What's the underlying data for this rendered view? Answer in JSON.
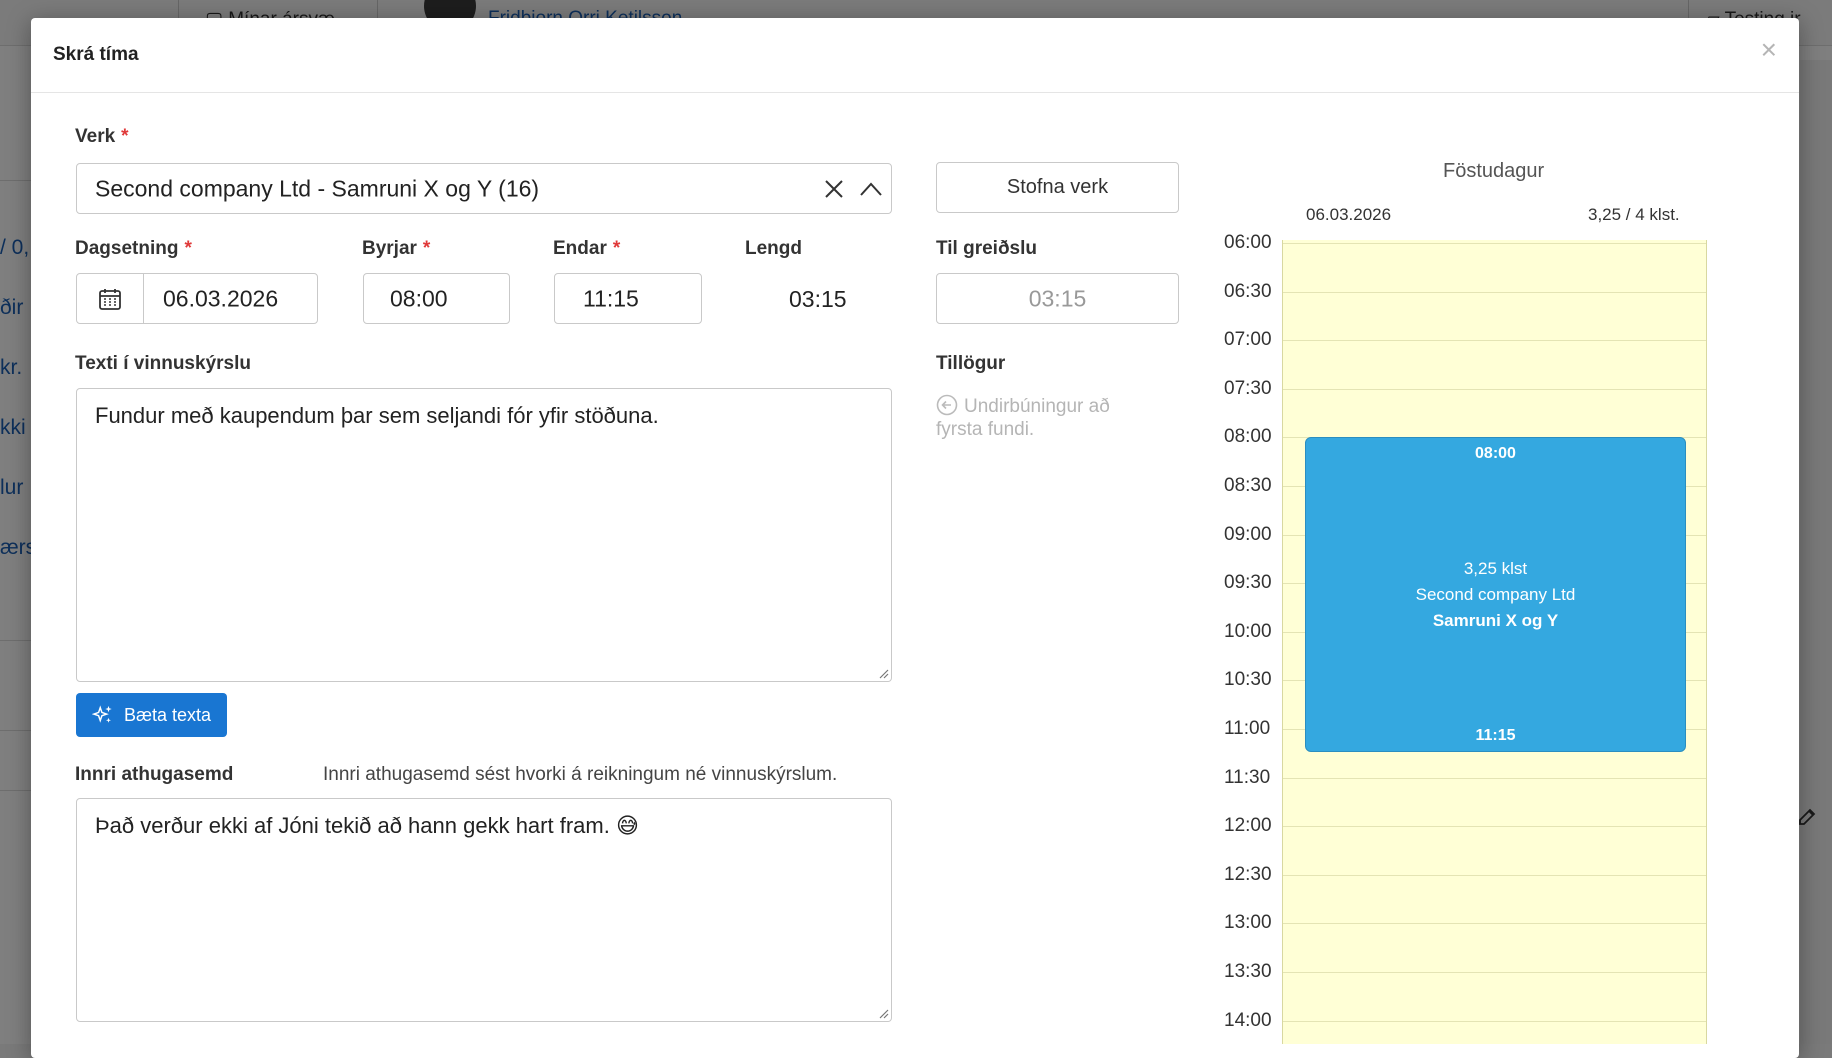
{
  "background": {
    "tab_label": "Mínar ársvæ...",
    "user_name": "Fridbjorn Orri Ketilsson",
    "right_tab": "Testing ir",
    "left_items": [
      "/ 0,",
      "ðir",
      "kr.",
      "kki",
      "lur",
      "ærs"
    ]
  },
  "modal": {
    "title": "Skrá tíma",
    "close_symbol": "×"
  },
  "form": {
    "verk": {
      "label": "Verk",
      "required_mark": "*",
      "value": "Second company Ltd - Samruni X og Y (16)"
    },
    "create_project_button": "Stofna verk",
    "date": {
      "label": "Dagsetning",
      "required_mark": "*",
      "value": "06.03.2026"
    },
    "start": {
      "label": "Byrjar",
      "required_mark": "*",
      "value": "08:00"
    },
    "end": {
      "label": "Endar",
      "required_mark": "*",
      "value": "11:15"
    },
    "length": {
      "label": "Lengd",
      "value": "03:15"
    },
    "billable": {
      "label": "Til greiðslu",
      "value": "03:15"
    },
    "work_text": {
      "label": "Texti í vinnuskýrslu",
      "value": "Fundur með kaupendum þar sem seljandi fór yfir stöðuna."
    },
    "improve_button": "Bæta texta",
    "suggestions": {
      "label": "Tillögur",
      "items": [
        "Undirbúningur að fyrsta fundi."
      ]
    },
    "internal_note": {
      "label": "Innri athugasemd",
      "hint": "Innri athugasemd sést hvorki á reikningum né vinnuskýrslum.",
      "value": "Það verður ekki af Jóni tekið að hann gekk hart fram. 😅"
    }
  },
  "calendar": {
    "day_name": "Föstudagur",
    "date": "06.03.2026",
    "summary": "3,25 / 4 klst.",
    "times": [
      "06:00",
      "06:30",
      "07:00",
      "07:30",
      "08:00",
      "08:30",
      "09:00",
      "09:30",
      "10:00",
      "10:30",
      "11:00",
      "11:30",
      "12:00",
      "12:30",
      "13:00",
      "13:30",
      "14:00"
    ],
    "event": {
      "start": "08:00",
      "end": "11:15",
      "duration": "3,25 klst",
      "company": "Second company Ltd",
      "project": "Samruni X og Y",
      "color": "#34a8e0"
    }
  }
}
